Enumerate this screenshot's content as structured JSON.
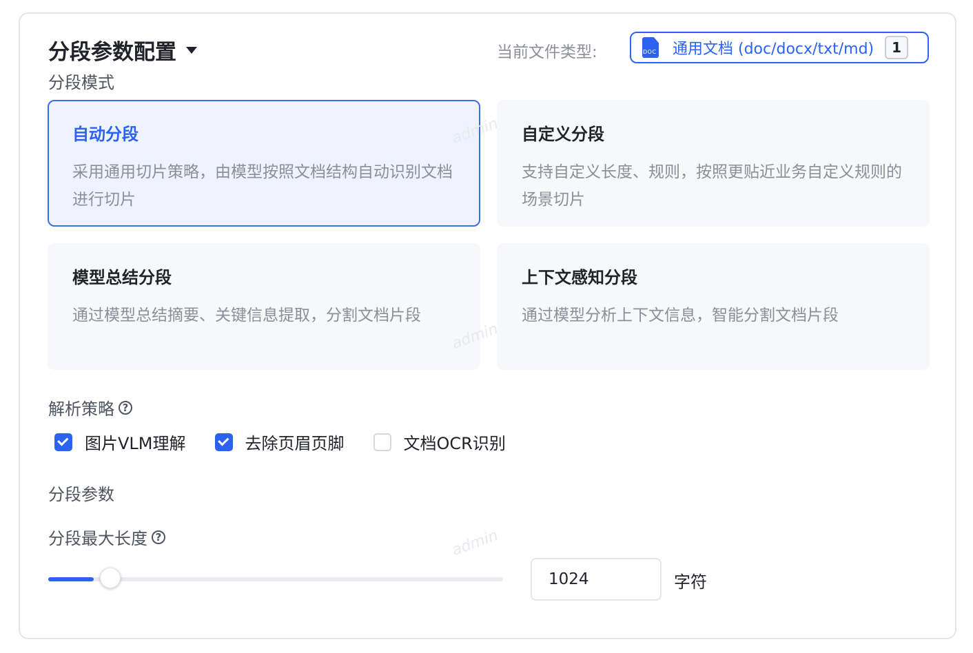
{
  "header": {
    "title": "分段参数配置",
    "file_type_label": "当前文件类型:",
    "file_type_icon": "doc-file-icon",
    "file_type_icon_text": "DOC",
    "file_type_value": "通用文档 (doc/docx/txt/md)",
    "file_type_count": "1"
  },
  "mode": {
    "label": "分段模式",
    "cards": [
      {
        "title": "自动分段",
        "desc": "采用通用切片策略，由模型按照文档结构自动识别文档进行切片",
        "selected": true
      },
      {
        "title": "自定义分段",
        "desc": "支持自定义长度、规则，按照更贴近业务自定义规则的场景切片",
        "selected": false
      },
      {
        "title": "模型总结分段",
        "desc": "通过模型总结摘要、关键信息提取，分割文档片段",
        "selected": false
      },
      {
        "title": "上下文感知分段",
        "desc": "通过模型分析上下文信息，智能分割文档片段",
        "selected": false
      }
    ]
  },
  "parse": {
    "label": "解析策略",
    "help_icon": "question-circle-icon",
    "options": [
      {
        "label": "图片VLM理解",
        "checked": true
      },
      {
        "label": "去除页眉页脚",
        "checked": true
      },
      {
        "label": "文档OCR识别",
        "checked": false
      }
    ]
  },
  "params": {
    "label": "分段参数",
    "max_length_label": "分段最大长度",
    "help_icon": "question-circle-icon",
    "slider_fraction": 0.1,
    "value": "1024",
    "unit": "字符"
  },
  "watermark": "admin",
  "colors": {
    "accent": "#2b62f0",
    "card_bg": "#f7f8fa",
    "selected_bg": "#eef3ff"
  }
}
